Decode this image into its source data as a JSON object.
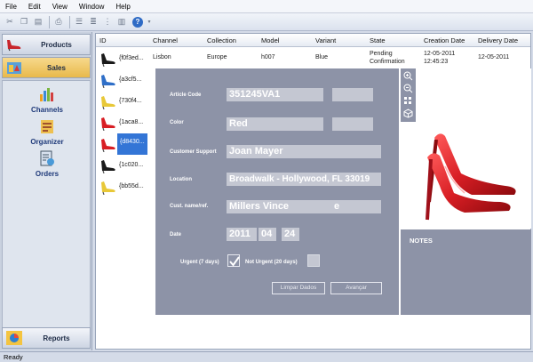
{
  "menu": [
    "File",
    "Edit",
    "View",
    "Window",
    "Help"
  ],
  "toolbar": {
    "help_label": "?"
  },
  "nav": {
    "products_label": "Products",
    "sales_label": "Sales",
    "reports_label": "Reports",
    "sub_items": [
      "Channels",
      "Organizer",
      "Orders"
    ]
  },
  "grid": {
    "columns": [
      "ID",
      "Channel",
      "Collection",
      "Model",
      "Variant",
      "State",
      "Creation Date",
      "Delivery Date"
    ],
    "first_row": {
      "channel": "Lisbon",
      "collection": "Europe",
      "model": "h007",
      "variant": "Blue",
      "state": "Pending Confirmation",
      "creation_date": "12-05-2011 12:45:23",
      "delivery_date": "12-05-2011"
    },
    "ids": [
      "{f0f3ed...",
      "{a3cf5...",
      "{730f4...",
      "{1aca8...",
      "{d8430...",
      "{1c020...",
      "{bb55d..."
    ],
    "selected_index": 4
  },
  "dialog": {
    "article_code_label": "Article Code",
    "article_code": "351245VA1",
    "color_label": "Color",
    "color": "Red",
    "support_label": "Customer Support",
    "support": "Joan Mayer",
    "location_label": "Location",
    "location": "Broadwalk - Hollywood, FL 33019",
    "cust_label": "Cust. name/ref.",
    "cust": "Millers Vince",
    "cust_suffix": "e",
    "date_label": "Date",
    "date_year": "2011",
    "date_month": "04",
    "date_day": "24",
    "urgent_label": "Urgent (7 days)",
    "not_urgent_label": "Not Urgent (20 days)",
    "clear_label": "Limpar Dados",
    "next_label": "Avançar"
  },
  "notes_label": "NOTES",
  "status": "Ready",
  "colors": {
    "accent": "#3375d6",
    "dialog": "#8d93a7",
    "shoe_red": "#d81e24"
  }
}
